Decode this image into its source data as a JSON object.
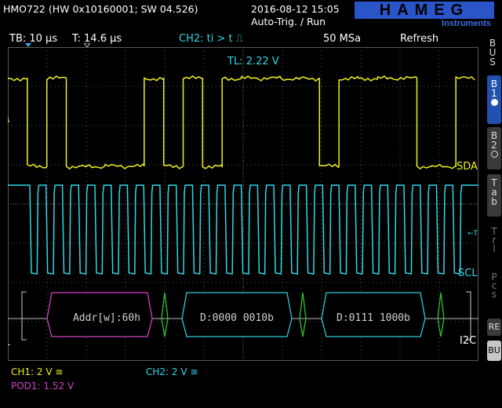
{
  "header": {
    "device": "HMO722 (HW 0x10160001; SW 04.526)",
    "datetime": "2016-08-12 15:05",
    "status": "Auto-Trig. / Run",
    "brand": "HAMEG",
    "brand_sub": "Instruments"
  },
  "infobar": {
    "timebase": "TB: 10 µs",
    "trigger_time": "T: 14.6 µs",
    "trigger_cond": "CH2: ti > t ⎍",
    "sample_rate": "50 MSa",
    "mode": "Refresh"
  },
  "display": {
    "trigger_level": "TL: 2.22 V",
    "sda_label": "SDA",
    "scl_label": "SCL",
    "bus_label": "I2C",
    "bus_marker": "BL",
    "ch1_markers": [
      "1↓",
      "1"
    ],
    "ch2_markers": [
      "2",
      "2"
    ],
    "trig_marker": "←T",
    "frames": [
      {
        "text": "Addr[w]:60h",
        "color": "#d040c8"
      },
      {
        "text": "D:0000 0010b",
        "color": "#30c8d8"
      },
      {
        "text": "D:0111 1000b",
        "color": "#30c8d8"
      }
    ]
  },
  "sidebar": {
    "bus": "BUS",
    "b1": "B1",
    "b2": "B2",
    "tab": "Tab",
    "trl": "Trl",
    "pcs": "Pcs",
    "re": "RE",
    "bu": "BU"
  },
  "footer": {
    "ch1": "CH1: 2 V ≅",
    "ch2": "CH2: 2 V ≅",
    "pod1": "POD1: 1.52 V"
  },
  "colors": {
    "ch1": "#f0f020",
    "ch2": "#30d8e8",
    "pod": "#d040c8",
    "grid": "#5a5a5a",
    "decode_delim": "#30c030",
    "accent_blue": "#2050b0"
  },
  "signals": {
    "sda_levels": [
      1,
      0,
      1,
      0,
      0,
      0,
      0,
      1,
      0,
      1,
      0,
      1,
      1,
      1,
      1,
      1,
      0,
      1,
      1,
      1,
      1,
      0,
      0,
      1
    ],
    "scl_pulses": 27
  }
}
